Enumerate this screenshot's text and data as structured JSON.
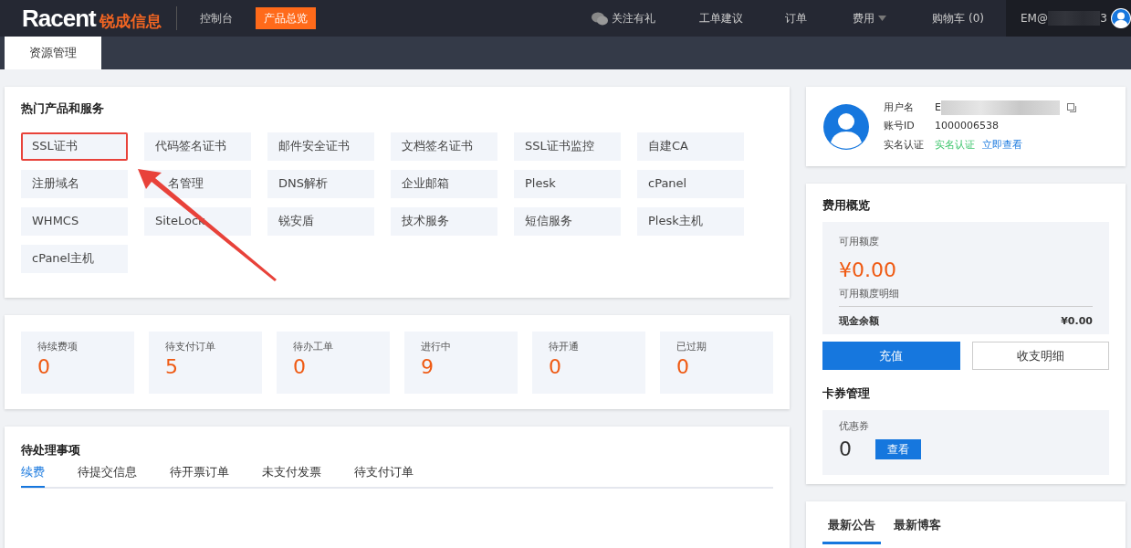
{
  "header": {
    "logo_latin": "Racent",
    "logo_cn": "锐成信息",
    "nav_links": [
      {
        "label": "控制台",
        "selected": false
      },
      {
        "label": "产品总览",
        "selected": true
      }
    ],
    "right_links": [
      {
        "kind": "wechat",
        "label": "关注有礼"
      },
      {
        "kind": "plain",
        "label": "工单建议"
      },
      {
        "kind": "plain",
        "label": "订单"
      },
      {
        "kind": "dropdown",
        "label": "费用"
      },
      {
        "kind": "plain",
        "label": "购物车 (0)"
      }
    ],
    "user_email_start": "EM@",
    "user_email_end": "3"
  },
  "page_tabs": [
    {
      "label": "资源管理",
      "selected": true
    }
  ],
  "products": {
    "title": "热门产品和服务",
    "items": [
      {
        "label": "SSL证书",
        "highlighted": true
      },
      {
        "label": "代码签名证书",
        "highlighted": false
      },
      {
        "label": "邮件安全证书",
        "highlighted": false
      },
      {
        "label": "文档签名证书",
        "highlighted": false
      },
      {
        "label": "SSL证书监控",
        "highlighted": false
      },
      {
        "label": "自建CA",
        "highlighted": false
      },
      {
        "label": "注册域名",
        "highlighted": false
      },
      {
        "label": "名管理",
        "highlighted": false
      },
      {
        "label": "DNS解析",
        "highlighted": false
      },
      {
        "label": "企业邮箱",
        "highlighted": false
      },
      {
        "label": "Plesk",
        "highlighted": false
      },
      {
        "label": "cPanel",
        "highlighted": false
      },
      {
        "label": "WHMCS",
        "highlighted": false
      },
      {
        "label": "SiteLock",
        "highlighted": false
      },
      {
        "label": "锐安盾",
        "highlighted": false
      },
      {
        "label": "技术服务",
        "highlighted": false
      },
      {
        "label": "短信服务",
        "highlighted": false
      },
      {
        "label": "Plesk主机",
        "highlighted": false
      },
      {
        "label": "cPanel主机",
        "highlighted": false
      }
    ]
  },
  "stats": [
    {
      "label": "待续费项",
      "value": "0"
    },
    {
      "label": "待支付订单",
      "value": "5"
    },
    {
      "label": "待办工单",
      "value": "0"
    },
    {
      "label": "进行中",
      "value": "9"
    },
    {
      "label": "待开通",
      "value": "0"
    },
    {
      "label": "已过期",
      "value": "0"
    }
  ],
  "pending": {
    "title": "待处理事项",
    "tabs": [
      {
        "label": "续费",
        "selected": true
      },
      {
        "label": "待提交信息",
        "selected": false
      },
      {
        "label": "待开票订单",
        "selected": false
      },
      {
        "label": "未支付发票",
        "selected": false
      },
      {
        "label": "待支付订单",
        "selected": false
      }
    ]
  },
  "profile": {
    "fields": [
      {
        "kind": "username",
        "label": "用户名",
        "value": "E"
      },
      {
        "kind": "plain",
        "label": "账号ID",
        "value": "1000006538"
      },
      {
        "kind": "verify",
        "label": "实名认证",
        "value": "实名认证",
        "link": "立即查看"
      }
    ]
  },
  "fees": {
    "title": "费用概览",
    "credit_label": "可用额度",
    "credit_value": "¥0.00",
    "credit_detail": "可用额度明细",
    "cash_label": "现金余额",
    "cash_value": "¥0.00",
    "buttons": [
      {
        "kind": "primary",
        "label": "充值"
      },
      {
        "kind": "outline",
        "label": "收支明细"
      }
    ],
    "coupons_title": "卡券管理",
    "coupon_label": "优惠券",
    "coupon_count": "0",
    "coupon_button": "查看"
  },
  "news_tabs": [
    {
      "label": "最新公告",
      "selected": true
    },
    {
      "label": "最新博客",
      "selected": false
    }
  ]
}
